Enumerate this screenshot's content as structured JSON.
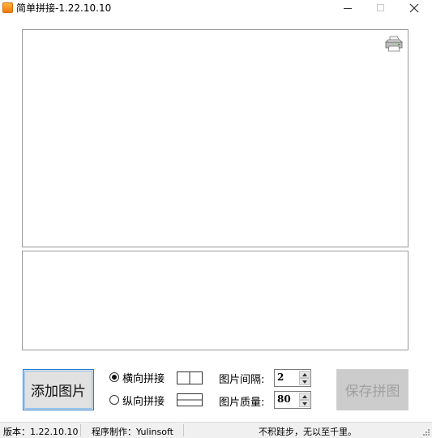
{
  "window": {
    "title": "简单拼接-1.22.10.10",
    "minimize_icon": "minimize-icon",
    "maximize_icon": "maximize-icon",
    "close_icon": "close-icon"
  },
  "preview": {
    "print_icon": "printer-icon"
  },
  "controls": {
    "add_button": "添加图片",
    "horizontal_label": "横向拼接",
    "vertical_label": "纵向拼接",
    "selected_mode": "横向拼接",
    "spacing_label": "图片间隔:",
    "spacing_value": "2",
    "quality_label": "图片质量:",
    "quality_value": "80",
    "save_button": "保存拼图"
  },
  "status": {
    "version": "版本：1.22.10.10",
    "author": "程序制作：Yulinsoft",
    "motto": "不积跬步，无以至千里。"
  },
  "colors": {
    "accent": "#1f7bd6",
    "disabled_text": "#a0a0a0",
    "app_icon": "#f59a1e"
  }
}
